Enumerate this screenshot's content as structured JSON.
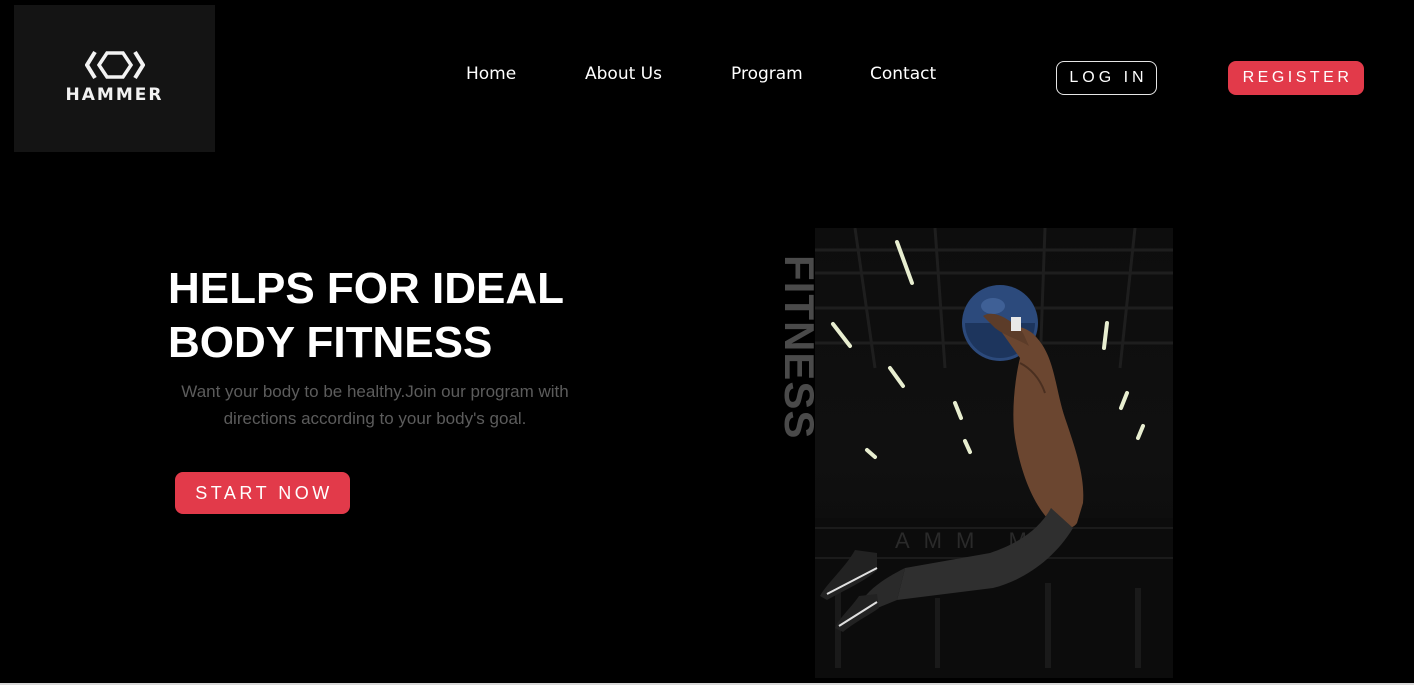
{
  "brand": {
    "name": "HAMMER",
    "logo_icon": "hexagon-brackets-icon"
  },
  "nav": {
    "links": [
      {
        "label": "Home"
      },
      {
        "label": "About Us"
      },
      {
        "label": "Program"
      },
      {
        "label": "Contact"
      }
    ],
    "login_label": "LOG IN",
    "register_label": "REGISTER"
  },
  "hero": {
    "title_line1": "HELPS FOR IDEAL",
    "title_line2": "BODY FITNESS",
    "subtitle": "Want your body to be healthy.Join our program with directions according to your body's goal.",
    "cta_label": "START NOW",
    "vertical_word": "FITNESS",
    "photo_subject": "athlete-jumping-with-medicine-ball"
  },
  "colors": {
    "background": "#000000",
    "accent": "#e23a4a",
    "text": "#ffffff",
    "muted_text": "#5c5c5c"
  }
}
